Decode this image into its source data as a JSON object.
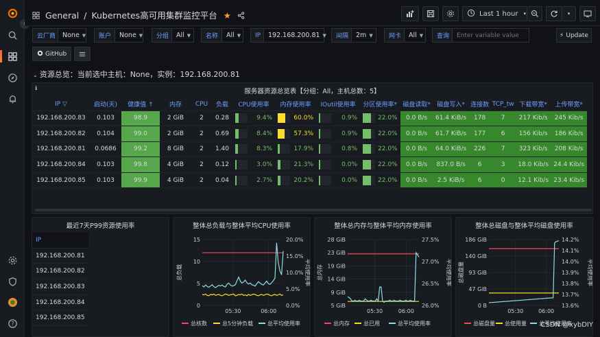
{
  "breadcrumb": {
    "folder": "General",
    "separator": "/",
    "title": "Kubernetes高可用集群监控平台"
  },
  "toolbar": {
    "time_range": "Last 1 hour"
  },
  "variables": [
    {
      "label": "云厂商",
      "value": "None"
    },
    {
      "label": "账户",
      "value": "None"
    },
    {
      "label": "分组",
      "value": "All"
    },
    {
      "label": "名称",
      "value": "All"
    },
    {
      "label": "IP",
      "value": "192.168.200.81"
    },
    {
      "label": "间隔",
      "value": "2m"
    },
    {
      "label": "网卡",
      "value": "All"
    },
    {
      "label": "查询",
      "value": "",
      "placeholder": "Enter variable value"
    }
  ],
  "update_label": "Update",
  "github_label": "GitHub",
  "row_title": "资源总览：当前选中主机：None，实例：192.168.200.81",
  "overview_panel": {
    "title": "服务器资源总览表【分组：All，主机总数：5】",
    "columns": [
      "IP",
      "启动(天)",
      "健康值",
      "内存",
      "CPU",
      "负载",
      "CPU使用率",
      "内存使用率",
      "IOutil使用率",
      "分区使用率*",
      "磁盘读取*",
      "磁盘写入*",
      "连接数",
      "TCP_tw",
      "下载带宽*",
      "上传带宽*"
    ],
    "rows": [
      {
        "ip": "192.168.200.83",
        "uptime": "0.103",
        "health": "98.9",
        "mem": "2 GiB",
        "cpu": "2",
        "load": "0.28",
        "cpu_pct": "9.4%",
        "cpu_f": 9.4,
        "mem_pct": "60.0%",
        "mem_f": 60.0,
        "io_pct": "0.9%",
        "io_f": 0.9,
        "part_pct": "22.0%",
        "part_f": 22.0,
        "disk_r": "0.0 B/s",
        "disk_w": "61.4 KiB/s",
        "conn": "178",
        "tcp_tw": "7",
        "down": "217 Kib/s",
        "up": "245 Kib/s"
      },
      {
        "ip": "192.168.200.82",
        "uptime": "0.104",
        "health": "99.0",
        "mem": "2 GiB",
        "cpu": "2",
        "load": "0.69",
        "cpu_pct": "8.4%",
        "cpu_f": 8.4,
        "mem_pct": "57.3%",
        "mem_f": 57.3,
        "io_pct": "0.9%",
        "io_f": 0.9,
        "part_pct": "22.0%",
        "part_f": 22.0,
        "disk_r": "0.0 B/s",
        "disk_w": "61.7 KiB/s",
        "conn": "177",
        "tcp_tw": "6",
        "down": "156 Kib/s",
        "up": "186 Kib/s"
      },
      {
        "ip": "192.168.200.81",
        "uptime": "0.0686",
        "health": "99.2",
        "mem": "8 GiB",
        "cpu": "2",
        "load": "1.40",
        "cpu_pct": "8.3%",
        "cpu_f": 8.3,
        "mem_pct": "17.9%",
        "mem_f": 17.9,
        "io_pct": "0.8%",
        "io_f": 0.8,
        "part_pct": "22.0%",
        "part_f": 22.0,
        "disk_r": "0.0 B/s",
        "disk_w": "64.0 KiB/s",
        "conn": "226",
        "tcp_tw": "7",
        "down": "323 Kib/s",
        "up": "208 Kib/s"
      },
      {
        "ip": "192.168.200.84",
        "uptime": "0.103",
        "health": "99.8",
        "mem": "4 GiB",
        "cpu": "2",
        "load": "0.12",
        "cpu_pct": "3.0%",
        "cpu_f": 3.0,
        "mem_pct": "21.3%",
        "mem_f": 21.3,
        "io_pct": "0.0%",
        "io_f": 0.0,
        "part_pct": "22.0%",
        "part_f": 22.0,
        "disk_r": "0.0 B/s",
        "disk_w": "837.0 B/s",
        "conn": "6",
        "tcp_tw": "3",
        "down": "18.0 Kib/s",
        "up": "24.4 Kib/s"
      },
      {
        "ip": "192.168.200.85",
        "uptime": "0.103",
        "health": "99.9",
        "mem": "4 GiB",
        "cpu": "2",
        "load": "0.04",
        "cpu_pct": "2.7%",
        "cpu_f": 2.7,
        "mem_pct": "20.2%",
        "mem_f": 20.2,
        "io_pct": "0.0%",
        "io_f": 0.0,
        "part_pct": "22.0%",
        "part_f": 22.0,
        "disk_r": "0.0 B/s",
        "disk_w": "2.5 KiB/s",
        "conn": "6",
        "tcp_tw": "0",
        "down": "12.1 Kib/s",
        "up": "23.4 Kib/s"
      }
    ]
  },
  "p99_panel": {
    "title": "最近7天P99资源使用率",
    "header": "IP",
    "ips": [
      "192.168.200.81",
      "192.168.200.82",
      "192.168.200.83",
      "192.168.200.84",
      "192.168.200.85"
    ]
  },
  "chart_data": [
    {
      "type": "line",
      "title": "整体总负载与整体平均CPU使用率",
      "ylabel": "总负载",
      "y2label": "平均使用率",
      "yticks": [
        "0",
        "5",
        "10",
        "15"
      ],
      "y2ticks": [
        "0.0%",
        "5.0%",
        "10.0%",
        "15.0%",
        "20.0%"
      ],
      "ylim": [
        0,
        15
      ],
      "y2lim": [
        0,
        20
      ],
      "categories": [
        "05:30",
        "06:00"
      ],
      "series": [
        {
          "name": "总核数",
          "axis": "left",
          "color": "#f2495c",
          "values": [
            12,
            12,
            12,
            12,
            12,
            12,
            12,
            12,
            12,
            12,
            12,
            12,
            12,
            12,
            12,
            12,
            12,
            12,
            12,
            12,
            12,
            12,
            12,
            12,
            12,
            12,
            12,
            12,
            12,
            12,
            12,
            12,
            12,
            12,
            12,
            12,
            12,
            12,
            12,
            12,
            12,
            12,
            12,
            12,
            12,
            12,
            12,
            12,
            12,
            12
          ]
        },
        {
          "name": "总5分钟负载",
          "axis": "left",
          "color": "#fade2a",
          "values": [
            2.5,
            2.4,
            2.6,
            2.3,
            2.2,
            2.5,
            2.4,
            2.6,
            2.3,
            2.4,
            2.5,
            2.3,
            2.2,
            2.4,
            2.6,
            2.5,
            2.3,
            2.4,
            2.5,
            2.6,
            2.2,
            2.3,
            2.5,
            2.4,
            2.6,
            2.3,
            2.4,
            2.2,
            2.5,
            2.3,
            2.4,
            2.6,
            2.5,
            2.3,
            2.2,
            2.4,
            2.5,
            2.3,
            2.4,
            2.6,
            2.5,
            2.3,
            2.2,
            2.4,
            2.5,
            2.3,
            2.4,
            2.6,
            2.3,
            2.4
          ]
        },
        {
          "name": "总平均使用率",
          "axis": "right",
          "color": "#8ae0e9",
          "values": [
            6.0,
            5.6,
            6.2,
            5.8,
            5.5,
            5.9,
            6.3,
            5.7,
            5.4,
            5.8,
            6.1,
            5.9,
            6.2,
            5.8,
            5.6,
            6.4,
            6.8,
            6.2,
            5.9,
            6.0,
            6.3,
            7.5,
            8.6,
            7.4,
            6.8,
            7.1,
            7.7,
            6.9,
            6.5,
            6.8,
            6.3,
            6.1,
            5.9,
            6.6,
            7.2,
            6.8,
            6.4,
            6.2,
            6.8,
            7.4,
            6.6,
            6.4,
            6.9,
            7.5,
            8.3,
            19.0,
            13.0,
            10.5,
            9.3,
            16.5
          ]
        }
      ]
    },
    {
      "type": "line",
      "title": "整体总内存与整体平均内存使用率",
      "ylabel": "总内存",
      "y2label": "平均使用率",
      "yticks": [
        "5 GiB",
        "9 GiB",
        "14 GiB",
        "19 GiB",
        "23 GiB",
        "28 GiB"
      ],
      "y2ticks": [
        "26.0%",
        "26.5%",
        "27.0%",
        "27.5%"
      ],
      "ylim": [
        5,
        28
      ],
      "y2lim": [
        26.0,
        27.5
      ],
      "categories": [
        "05:30",
        "06:00"
      ],
      "series": [
        {
          "name": "总内存",
          "axis": "left",
          "color": "#f2495c",
          "values": [
            23,
            23,
            23,
            23,
            23,
            23,
            23,
            23,
            23,
            23,
            23,
            23,
            23,
            23,
            23,
            23,
            23,
            23,
            23,
            23,
            23,
            23,
            23,
            23,
            23,
            23,
            23,
            23,
            23,
            23,
            23,
            23,
            23,
            23,
            23,
            23,
            23,
            23,
            23,
            23,
            23,
            23,
            23,
            23,
            23,
            23,
            23,
            23,
            23,
            23
          ]
        },
        {
          "name": "总已用",
          "axis": "left",
          "color": "#fade2a",
          "values": [
            6.4,
            6.4,
            6.4,
            6.4,
            6.4,
            6.4,
            6.4,
            6.4,
            6.4,
            6.4,
            6.4,
            6.4,
            6.4,
            6.4,
            6.4,
            6.4,
            6.4,
            6.4,
            6.4,
            6.4,
            6.4,
            6.4,
            6.4,
            6.4,
            6.4,
            6.4,
            6.4,
            6.4,
            6.4,
            6.4,
            6.4,
            6.4,
            6.4,
            6.4,
            6.4,
            6.4,
            6.4,
            6.4,
            6.4,
            6.4,
            6.4,
            6.4,
            6.4,
            6.4,
            6.4,
            6.4,
            6.4,
            6.4,
            6.4,
            6.4
          ]
        },
        {
          "name": "总平均使用率",
          "axis": "right",
          "color": "#8ae0e9",
          "values": [
            26.2,
            26.18,
            26.15,
            26.1,
            26.1,
            26.12,
            26.1,
            26.1,
            26.12,
            26.1,
            26.1,
            26.1,
            26.15,
            26.12,
            26.1,
            26.1,
            26.12,
            26.1,
            26.1,
            26.1,
            26.15,
            26.1,
            26.42,
            26.42,
            26.1,
            26.07,
            26.1,
            26.1,
            26.1,
            26.12,
            26.1,
            26.1,
            26.12,
            26.1,
            26.1,
            26.1,
            26.12,
            26.1,
            26.1,
            26.1,
            26.12,
            26.1,
            26.1,
            26.12,
            26.1,
            26.1,
            26.1,
            27.2,
            27.15,
            27.1
          ]
        }
      ]
    },
    {
      "type": "line",
      "title": "整体总磁盘与整体平均磁盘使用率",
      "ylabel": "总磁盘量",
      "y2label": "平均使用率",
      "yticks": [
        "0 B",
        "47 GiB",
        "93 GiB",
        "140 GiB",
        "186 GiB"
      ],
      "y2ticks": [
        "13.6%",
        "13.7%",
        "13.8%",
        "13.9%",
        "14.0%",
        "14.1%",
        "14.2%"
      ],
      "ylim": [
        0,
        186
      ],
      "y2lim": [
        13.6,
        14.2
      ],
      "categories": [
        "05:30",
        "06:00"
      ],
      "series": [
        {
          "name": "总磁盘量",
          "axis": "left",
          "color": "#f2495c",
          "values": [
            160,
            160,
            160,
            160,
            160,
            160,
            160,
            160,
            160,
            160,
            160,
            160,
            160,
            160,
            160,
            160,
            160,
            160,
            160,
            160,
            160,
            160,
            160,
            160,
            160,
            160,
            160,
            160,
            160,
            160,
            160,
            160,
            160,
            160,
            160,
            160,
            160,
            160,
            160,
            160,
            160,
            160,
            160,
            160,
            160,
            160,
            160,
            160,
            160,
            160
          ]
        },
        {
          "name": "总使用量",
          "axis": "left",
          "color": "#fade2a",
          "values": [
            35,
            35,
            35,
            35,
            35,
            35,
            35,
            35,
            35,
            35,
            35,
            35,
            35,
            35,
            35,
            35,
            35,
            35,
            35,
            35,
            35,
            35,
            35,
            35,
            35,
            35,
            35,
            35,
            35,
            35,
            35,
            35,
            35,
            35,
            35,
            35,
            35,
            35,
            35,
            35,
            35,
            35,
            35,
            35,
            35,
            35,
            35,
            35,
            35,
            35
          ]
        },
        {
          "name": "总平均使用率",
          "axis": "right",
          "color": "#8ae0e9",
          "values": [
            13.625,
            13.626,
            13.627,
            13.628,
            13.629,
            13.63,
            13.631,
            13.632,
            13.633,
            13.634,
            13.635,
            13.636,
            13.637,
            13.638,
            13.639,
            13.64,
            13.641,
            13.642,
            13.643,
            13.644,
            13.645,
            13.646,
            13.647,
            13.648,
            13.649,
            13.65,
            13.651,
            13.652,
            13.653,
            13.654,
            13.655,
            13.656,
            13.657,
            13.658,
            13.659,
            13.66,
            13.661,
            13.662,
            13.663,
            13.664,
            13.665,
            13.666,
            13.667,
            13.668,
            13.669,
            13.67,
            14.17,
            14.18,
            14.185,
            14.19
          ]
        }
      ]
    }
  ],
  "watermark": "CSDN @xybDIY"
}
